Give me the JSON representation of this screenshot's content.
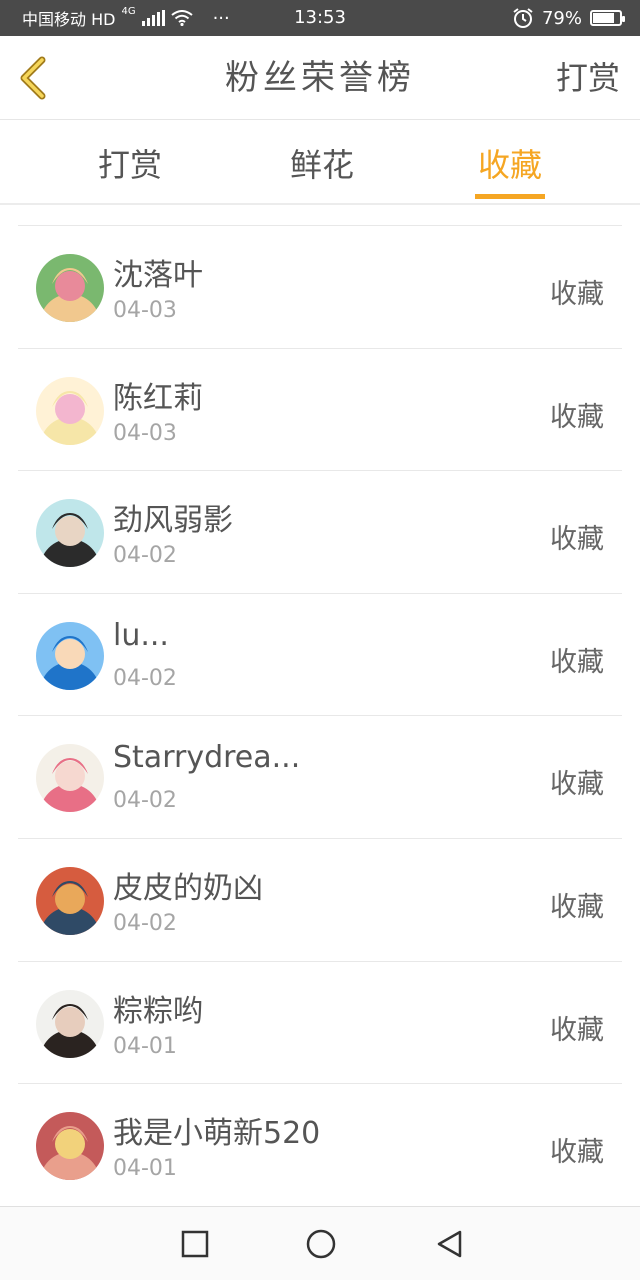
{
  "status_bar": {
    "carrier": "中国移动 HD",
    "network": "4G",
    "dots": "···",
    "time": "13:53",
    "battery_text": "79%",
    "battery_level": 0.79
  },
  "header": {
    "back_icon": "chevron-left-icon",
    "title": "粉丝荣誉榜",
    "action_label": "打赏"
  },
  "tabs": [
    {
      "label": "打赏",
      "active": false
    },
    {
      "label": "鲜花",
      "active": false
    },
    {
      "label": "收藏",
      "active": true
    }
  ],
  "accent_color": "#f5a623",
  "list": [
    {
      "name": "沈落叶",
      "date": "04-03",
      "action": "收藏",
      "avatar_colors": [
        "#f1c88e",
        "#e88a9a",
        "#7ab86f"
      ]
    },
    {
      "name": "陈红莉",
      "date": "04-03",
      "action": "收藏",
      "avatar_colors": [
        "#f6e6a8",
        "#f3b6cf",
        "#fff2d6"
      ]
    },
    {
      "name": "劲风弱影",
      "date": "04-02",
      "action": "收藏",
      "avatar_colors": [
        "#2b2b2b",
        "#e8d5c4",
        "#bfe6ea"
      ]
    },
    {
      "name": "lu...",
      "date": "04-02",
      "action": "收藏",
      "avatar_colors": [
        "#1f74c9",
        "#f9d9b8",
        "#7fc1f3"
      ]
    },
    {
      "name": "Starrydrea...",
      "date": "04-02",
      "action": "收藏",
      "avatar_colors": [
        "#e86f86",
        "#f6d8d0",
        "#f4f0e8"
      ]
    },
    {
      "name": "皮皮的奶凶",
      "date": "04-02",
      "action": "收藏",
      "avatar_colors": [
        "#2f4a66",
        "#e9a85a",
        "#d65c3f"
      ]
    },
    {
      "name": "粽粽哟",
      "date": "04-01",
      "action": "收藏",
      "avatar_colors": [
        "#2a2320",
        "#e7cdbd",
        "#f1f1ee"
      ]
    },
    {
      "name": "我是小萌新520",
      "date": "04-01",
      "action": "收藏",
      "avatar_colors": [
        "#e99f8c",
        "#f2d27b",
        "#c45a5a"
      ]
    }
  ],
  "nav": {
    "recent_icon": "square-icon",
    "home_icon": "circle-icon",
    "back_icon": "triangle-back-icon"
  }
}
